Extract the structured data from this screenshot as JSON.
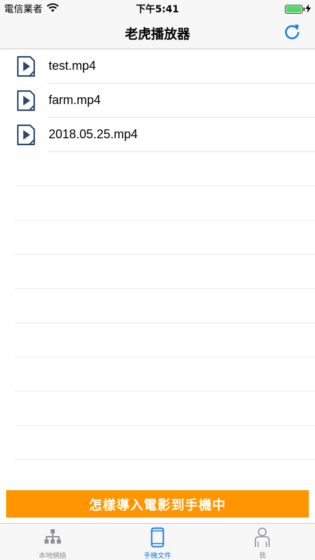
{
  "status_bar": {
    "carrier": "電信業者",
    "time": "下午5:41",
    "battery_level": 1.0
  },
  "nav_bar": {
    "title": "老虎播放器",
    "refresh_icon": "refresh-icon"
  },
  "files": [
    {
      "name": "test.mp4",
      "icon": "video-file-icon"
    },
    {
      "name": "farm.mp4",
      "icon": "video-file-icon"
    },
    {
      "name": "2018.05.25.mp4",
      "icon": "video-file-icon"
    }
  ],
  "help_banner": {
    "label": "怎樣導入電影到手機中"
  },
  "tab_bar": {
    "tabs": [
      {
        "label": "本地網絡",
        "icon": "network-icon",
        "active": false
      },
      {
        "label": "手機文件",
        "icon": "phone-icon",
        "active": true
      },
      {
        "label": "我",
        "icon": "person-icon",
        "active": false
      }
    ]
  },
  "colors": {
    "accent": "#1a7ce6",
    "banner": "#ff9500",
    "file_icon": "#2b4a6b",
    "battery": "#4cd964"
  }
}
